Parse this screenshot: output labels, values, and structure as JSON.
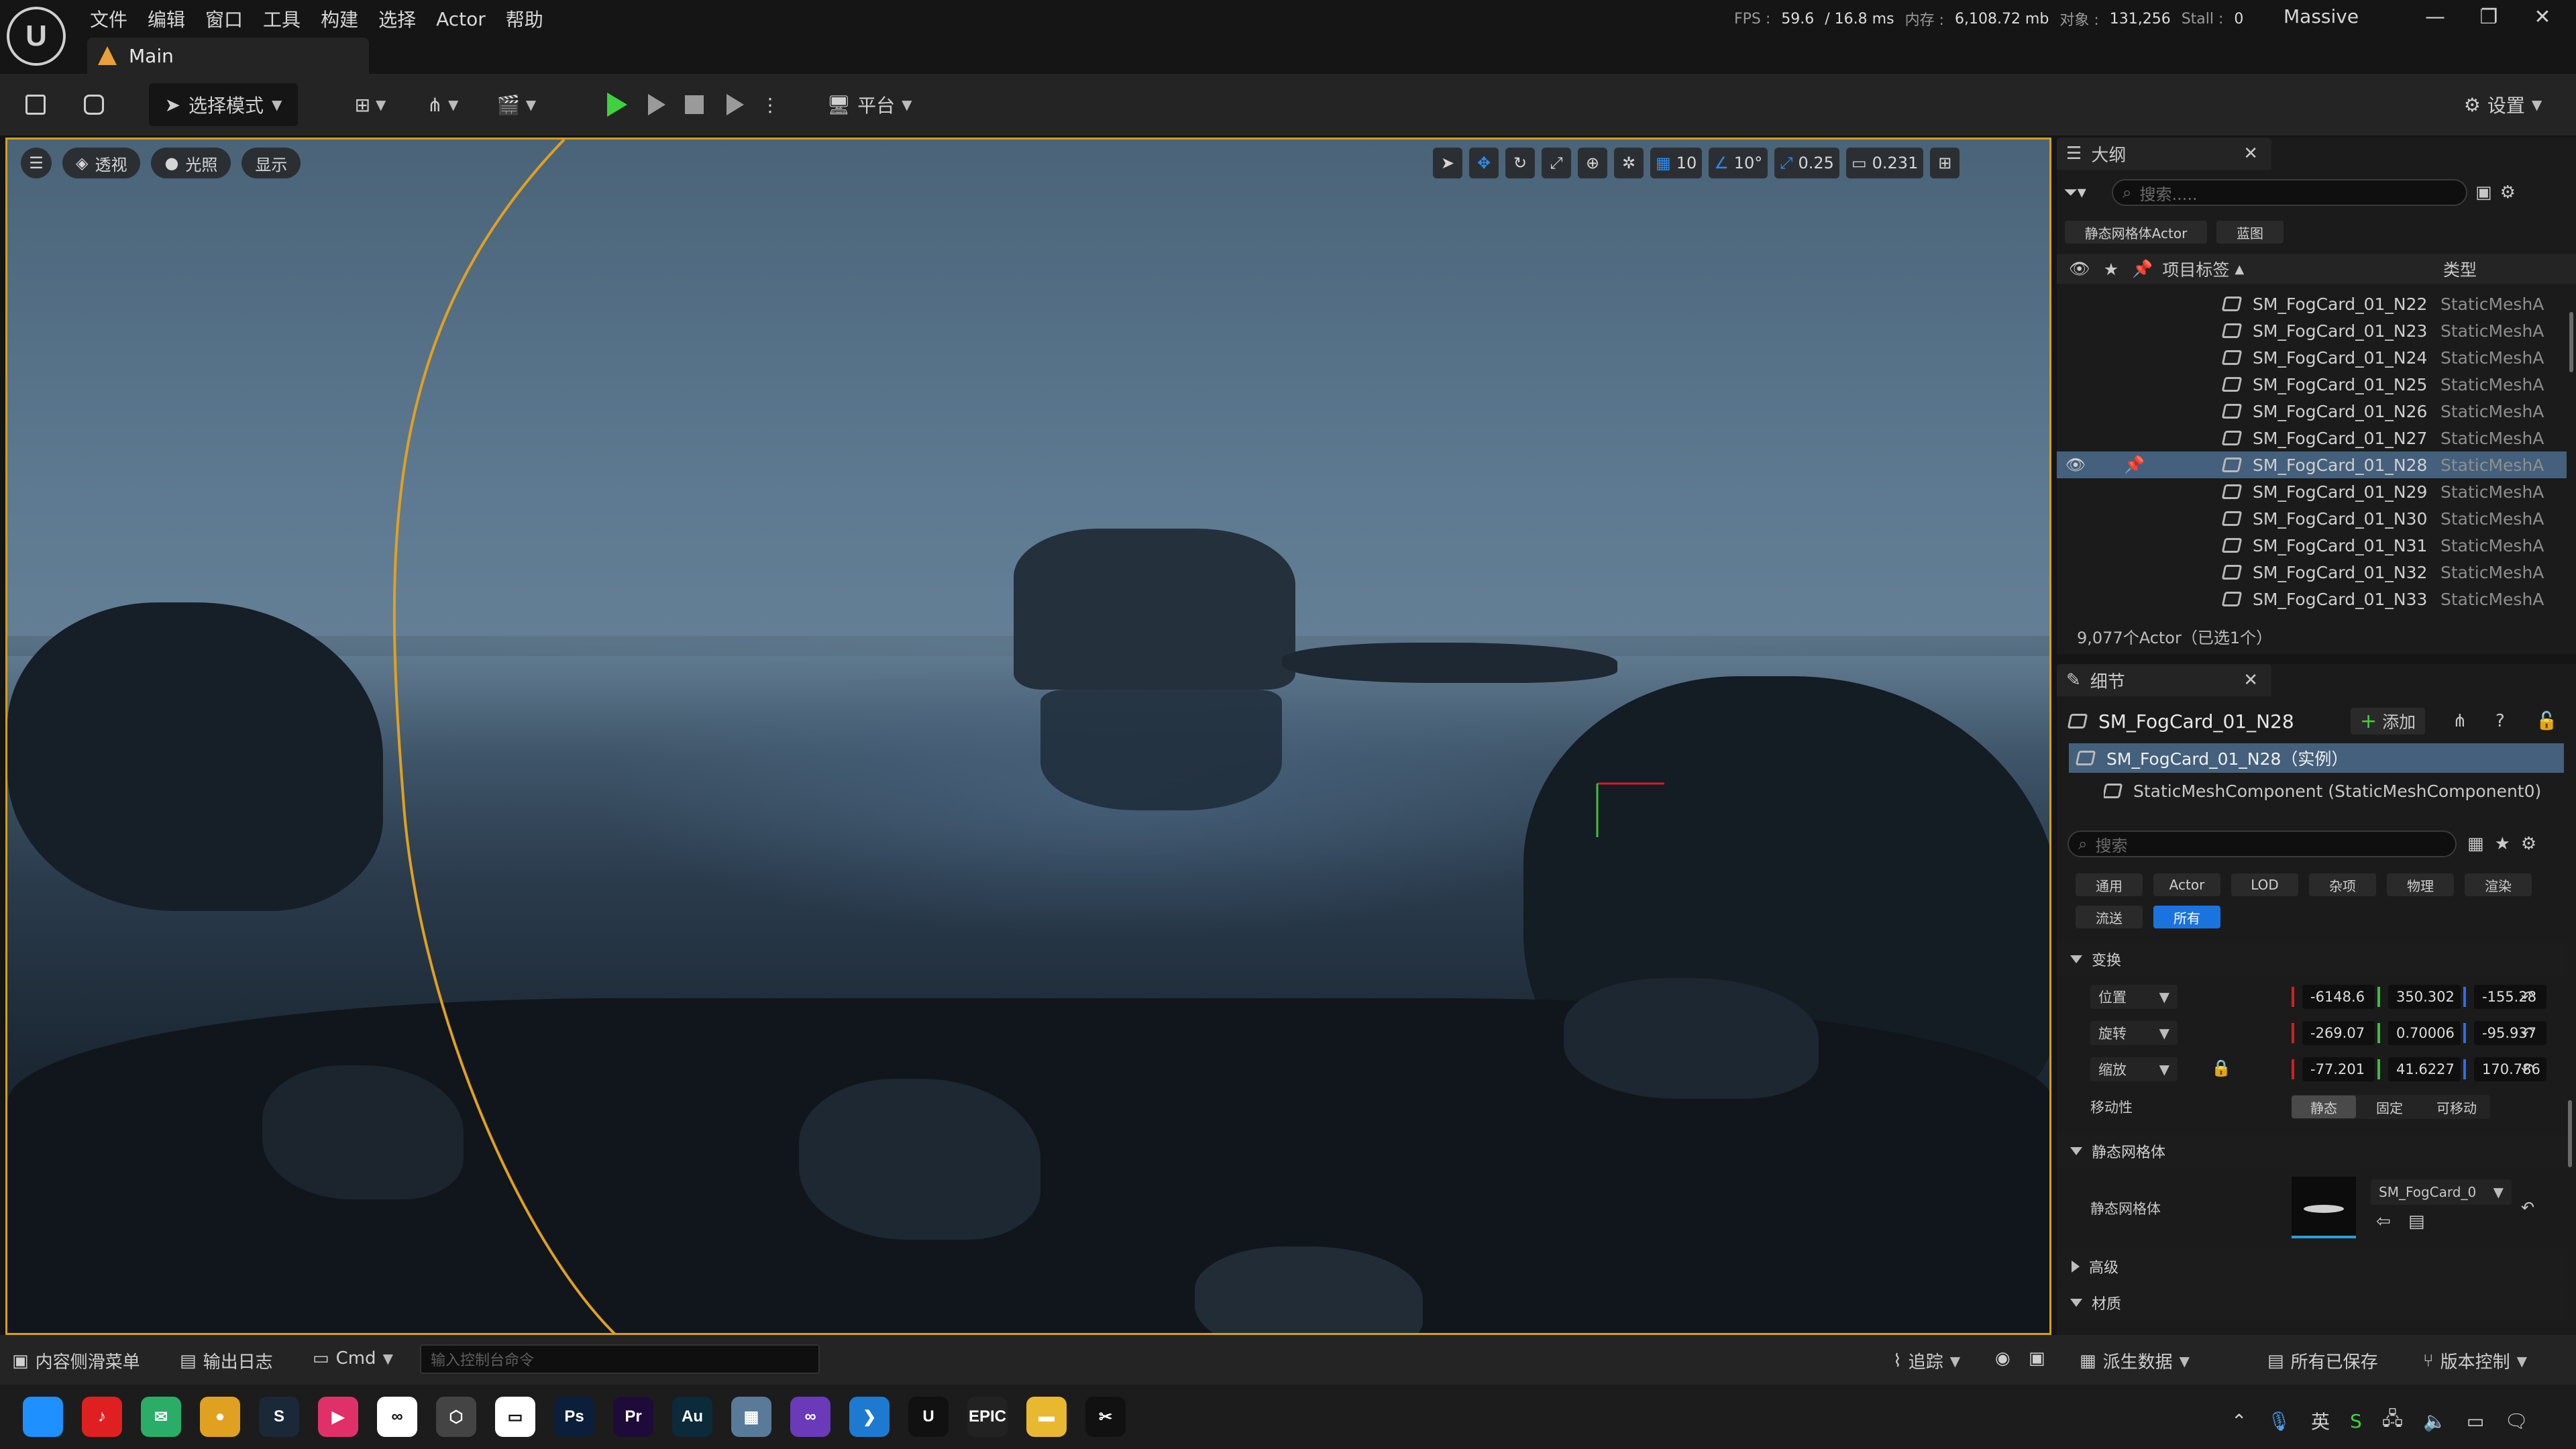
{
  "app": {
    "menu": [
      "文件",
      "编辑",
      "窗口",
      "工具",
      "构建",
      "选择",
      "Actor",
      "帮助"
    ],
    "tab_title": "Main",
    "project_name": "Massive",
    "stats": {
      "fps_label": "FPS :",
      "fps": "59.6",
      "frame_ms": "/ 16.8 ms",
      "mem_label": "内存 :",
      "mem": "6,108.72 mb",
      "objects_label": "对象 :",
      "objects": "131,256",
      "stall_label": "Stall :",
      "stall": "0"
    },
    "window_controls": [
      "—",
      "❐",
      "✕"
    ]
  },
  "toolbar": {
    "select_mode": "选择模式",
    "platform": "平台",
    "settings": "设置"
  },
  "viewport": {
    "perspective": "透视",
    "lighting": "光照",
    "show": "显示",
    "grid_snap": "10",
    "rotate_snap": "10°",
    "scale_snap": "0.25",
    "camera_speed": "0.231"
  },
  "outliner": {
    "title": "大纲",
    "search_placeholder": "搜索.....",
    "filters": [
      "静态网格体Actor",
      "蓝图"
    ],
    "col_label": "项目标签",
    "col_type": "类型",
    "items": [
      {
        "label": "SM_FogCard_01_N22",
        "type": "StaticMeshA",
        "selected": false
      },
      {
        "label": "SM_FogCard_01_N23",
        "type": "StaticMeshA",
        "selected": false
      },
      {
        "label": "SM_FogCard_01_N24",
        "type": "StaticMeshA",
        "selected": false
      },
      {
        "label": "SM_FogCard_01_N25",
        "type": "StaticMeshA",
        "selected": false
      },
      {
        "label": "SM_FogCard_01_N26",
        "type": "StaticMeshA",
        "selected": false
      },
      {
        "label": "SM_FogCard_01_N27",
        "type": "StaticMeshA",
        "selected": false
      },
      {
        "label": "SM_FogCard_01_N28",
        "type": "StaticMeshA",
        "selected": true
      },
      {
        "label": "SM_FogCard_01_N29",
        "type": "StaticMeshA",
        "selected": false
      },
      {
        "label": "SM_FogCard_01_N30",
        "type": "StaticMeshA",
        "selected": false
      },
      {
        "label": "SM_FogCard_01_N31",
        "type": "StaticMeshA",
        "selected": false
      },
      {
        "label": "SM_FogCard_01_N32",
        "type": "StaticMeshA",
        "selected": false
      },
      {
        "label": "SM_FogCard_01_N33",
        "type": "StaticMeshA",
        "selected": false
      }
    ],
    "count": "9,077个Actor（已选1个）"
  },
  "details": {
    "title": "细节",
    "actor_name": "SM_FogCard_01_N28",
    "add_label": "添加",
    "instance": "SM_FogCard_01_N28（实例）",
    "component": "StaticMeshComponent (StaticMeshComponent0)",
    "search_placeholder": "搜索",
    "filter_tabs": [
      "通用",
      "Actor",
      "LOD",
      "杂项",
      "物理",
      "渲染"
    ],
    "filter_tabs2": [
      "流送",
      "所有"
    ],
    "transform_section": "变换",
    "location_label": "位置",
    "rotation_label": "旋转",
    "scale_label": "缩放",
    "location": [
      "-6148.6",
      "350.302",
      "-155.28"
    ],
    "rotation": [
      "-269.07",
      "0.70006",
      "-95.937"
    ],
    "scale": [
      "-77.201",
      "41.6227",
      "170.786"
    ],
    "mobility_label": "移动性",
    "mobility_options": [
      "静态",
      "固定",
      "可移动"
    ],
    "static_mesh_section": "静态网格体",
    "static_mesh_label": "静态网格体",
    "static_mesh_value": "SM_FogCard_0",
    "advanced_section": "高级",
    "materials_section": "材质"
  },
  "statusbar": {
    "content_drawer": "内容侧滑菜单",
    "output_log": "输出日志",
    "cmd": "Cmd",
    "cmd_placeholder": "输入控制台命令",
    "trace": "追踪",
    "derived_data": "派生数据",
    "saved": "所有已保存",
    "source_control": "版本控制"
  },
  "taskbar": {
    "apps": [
      {
        "name": "windows-start",
        "label": "",
        "color": "#1e90ff"
      },
      {
        "name": "netease-music",
        "label": "♪",
        "color": "#e02020"
      },
      {
        "name": "wechat",
        "label": "✉",
        "color": "#2aae67"
      },
      {
        "name": "chrome",
        "label": "●",
        "color": "#e0a020"
      },
      {
        "name": "steam",
        "label": "S",
        "color": "#1b2838"
      },
      {
        "name": "app-pink",
        "label": "▶",
        "color": "#e0306a"
      },
      {
        "name": "meta",
        "label": "∞",
        "color": "#ffffff"
      },
      {
        "name": "app-hex",
        "label": "⬡",
        "color": "#444444"
      },
      {
        "name": "app-box",
        "label": "▭",
        "color": "#ffffff"
      },
      {
        "name": "photoshop",
        "label": "Ps",
        "color": "#0b1e3a"
      },
      {
        "name": "premiere",
        "label": "Pr",
        "color": "#1e0b3a"
      },
      {
        "name": "audition",
        "label": "Au",
        "color": "#0b2a3a"
      },
      {
        "name": "calculator",
        "label": "▦",
        "color": "#5a7a99"
      },
      {
        "name": "visual-studio",
        "label": "∞",
        "color": "#6a3ab8"
      },
      {
        "name": "vscode",
        "label": "❯",
        "color": "#1e7ad0"
      },
      {
        "name": "unreal",
        "label": "U",
        "color": "#111111"
      },
      {
        "name": "epic",
        "label": "EPIC",
        "color": "#222222"
      },
      {
        "name": "explorer",
        "label": "▬",
        "color": "#e8b830"
      },
      {
        "name": "capcut",
        "label": "✂",
        "color": "#111111"
      }
    ],
    "ime": "英"
  }
}
